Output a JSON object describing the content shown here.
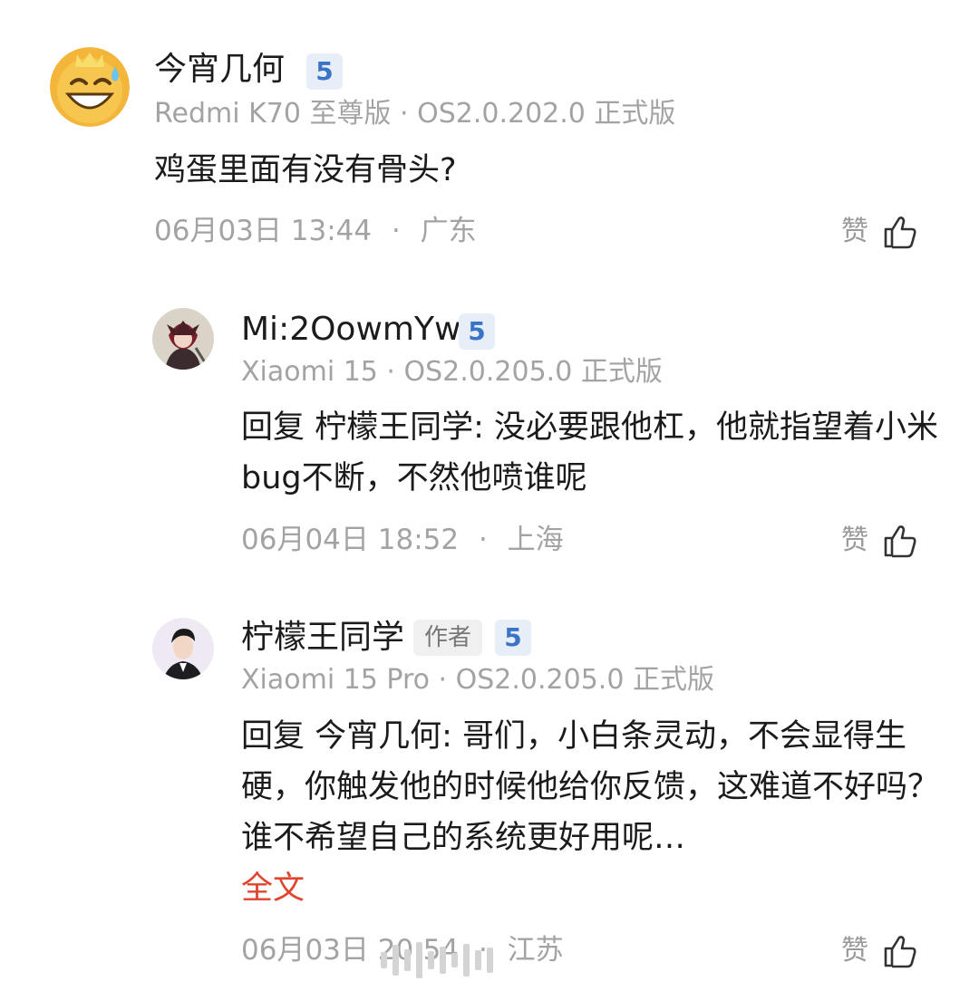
{
  "comments": [
    {
      "username": "今宵几何",
      "level": "5",
      "author_tag": "",
      "device": "Redmi K70 至尊版 · OS2.0.202.0 正式版",
      "text": "鸡蛋里面有没有骨头?",
      "full_link": "",
      "time": "06月03日 13:44",
      "sep": "·",
      "location": "广东",
      "like_label": "赞"
    },
    {
      "username": "Mi:2OowmYw",
      "level": "5",
      "author_tag": "",
      "device": "Xiaomi 15 · OS2.0.205.0 正式版",
      "text": "回复 柠檬王同学: 没必要跟他杠，他就指望着小米bug不断，不然他喷谁呢",
      "full_link": "",
      "time": "06月04日 18:52",
      "sep": "·",
      "location": "上海",
      "like_label": "赞"
    },
    {
      "username": "柠檬王同学",
      "level": "5",
      "author_tag": "作者",
      "device": "Xiaomi 15 Pro · OS2.0.205.0 正式版",
      "text": "回复 今宵几何: 哥们，小白条灵动，不会显得生硬，你触发他的时候他给你反馈，这难道不好吗？谁不希望自己的系统更好用呢…",
      "full_link": "全文",
      "time": "06月03日 20:54",
      "sep": "·",
      "location": "江苏",
      "like_label": "赞"
    }
  ],
  "icons": {
    "avatar_1": "smiling-face-with-sweat-icon",
    "avatar_2": "anime-character-avatar",
    "avatar_3": "man-portrait-avatar",
    "like": "thumbs-up-icon"
  },
  "colors": {
    "level_badge_text": "#3a74c6",
    "level_badge_bg": "#e8eef7",
    "full_text_link": "#e0442c",
    "meta_gray": "#a3a3a3"
  }
}
